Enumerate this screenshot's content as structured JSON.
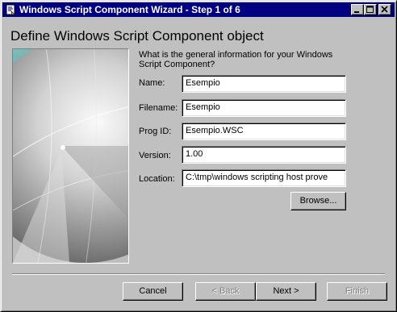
{
  "window": {
    "title": "Windows Script Component Wizard - Step 1 of 6",
    "controls": [
      "minimize-icon",
      "maximize-icon",
      "close-icon"
    ]
  },
  "page": {
    "heading": "Define Windows Script Component object",
    "description": "What is the general information for your Windows Script Component?"
  },
  "fields": {
    "name": {
      "label": "Name:",
      "value": "Esempio"
    },
    "filename": {
      "label": "Filename:",
      "value": "Esempio"
    },
    "progid": {
      "label": "Prog ID:",
      "value": "Esempio.WSC"
    },
    "version": {
      "label": "Version:",
      "value": "1.00"
    },
    "location": {
      "label": "Location:",
      "value": "C:\\tmp\\windows scripting host prove"
    }
  },
  "buttons": {
    "browse": "Browse...",
    "cancel": "Cancel",
    "back": "< Back",
    "next": "Next >",
    "finish": "Finish"
  },
  "colors": {
    "titlebar": "#000080",
    "face": "#c0c0c0",
    "teal_accent": "#5fa8a8"
  }
}
